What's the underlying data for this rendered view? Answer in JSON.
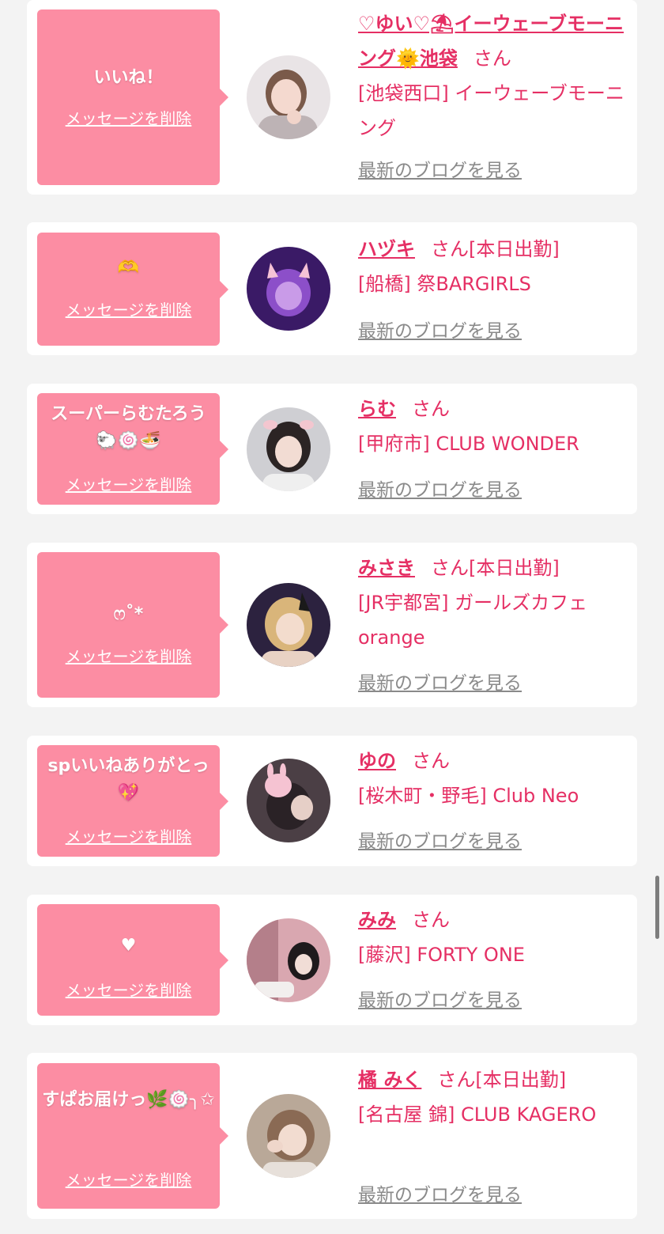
{
  "colors": {
    "background": "#f3f3f3",
    "card": "#ffffff",
    "bubble": "#fc8da3",
    "accent": "#e52f64",
    "link_gray": "#8a8a8a"
  },
  "common": {
    "delete_label": "メッセージを削除",
    "blog_label": "最新のブログを見る",
    "san": "さん",
    "today": "[本日出勤]"
  },
  "items": [
    {
      "message": "いいね！",
      "name": "♡ゆい♡⛱イーウェーブモーニング🌞池袋",
      "today": "",
      "shop": "[池袋西口] イーウェーブモーニング"
    },
    {
      "message": "🫶",
      "name": "ハヅキ",
      "today": "[本日出勤]",
      "shop": "[船橋] 祭BARGIRLS"
    },
    {
      "message": "スーパーらむたろう🐑🍥🍜",
      "name": "らむ",
      "today": "",
      "shop": "[甲府市] CLUB WONDER"
    },
    {
      "message": "ෆ˚*",
      "name": "みさき",
      "today": "[本日出勤]",
      "shop": "[JR宇都宮] ガールズカフェorange"
    },
    {
      "message": "spいいねありがとっ💖",
      "name": "ゆの",
      "today": "",
      "shop": "[桜木町・野毛] Club Neo"
    },
    {
      "message": "♥",
      "name": "みみ",
      "today": "",
      "shop": "[藤沢] FORTY ONE"
    },
    {
      "message": "すぱお届けっ🌿🍥╮✩",
      "name": "橘 みく",
      "today": "[本日出勤]",
      "shop": "[名古屋 錦] CLUB KAGERO"
    }
  ]
}
